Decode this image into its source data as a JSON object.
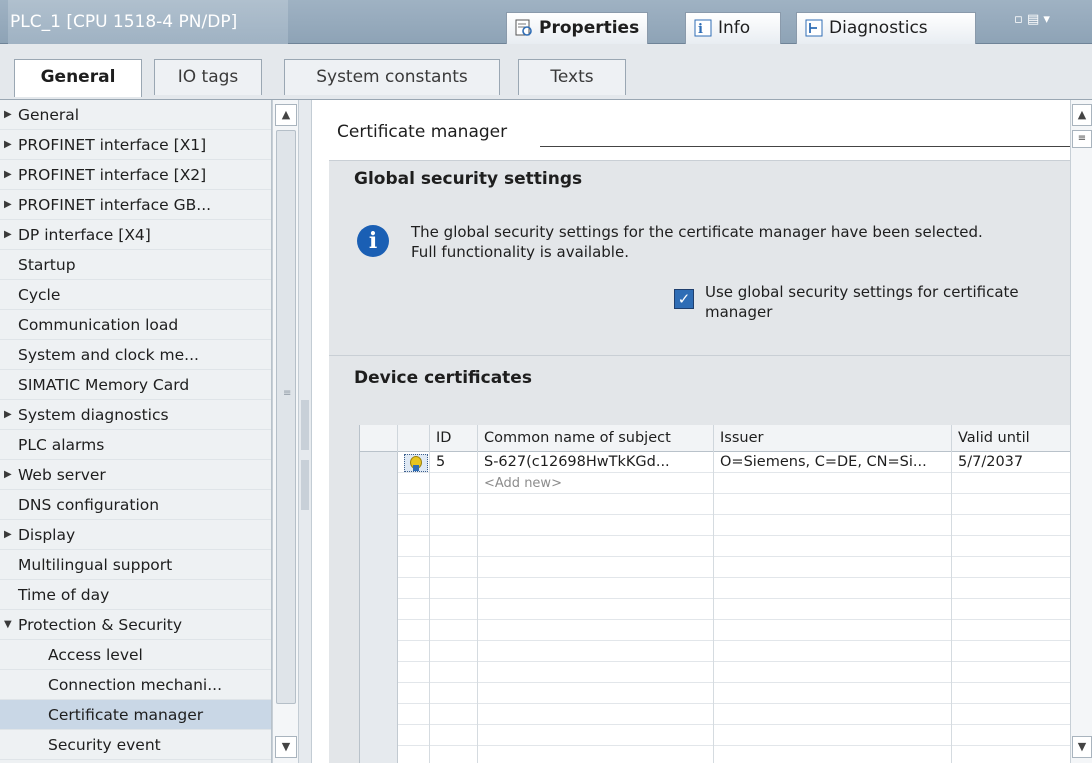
{
  "title_bar": {
    "title": "PLC_1 [CPU 1518-4 PN/DP]",
    "tabs": [
      {
        "label": "Properties",
        "icon": "properties-icon"
      },
      {
        "label": "Info",
        "icon": "info-tab-icon"
      },
      {
        "label": "Diagnostics",
        "icon": "diagnostics-icon"
      }
    ],
    "window_controls": "▫ ▤ ▾"
  },
  "sub_tabs": [
    "General",
    "IO tags",
    "System constants",
    "Texts"
  ],
  "nav": {
    "items": [
      {
        "label": "General",
        "arrow": "▶"
      },
      {
        "label": "PROFINET interface [X1]",
        "arrow": "▶"
      },
      {
        "label": "PROFINET interface [X2]",
        "arrow": "▶"
      },
      {
        "label": "PROFINET interface GB...",
        "arrow": "▶"
      },
      {
        "label": "DP interface [X4]",
        "arrow": "▶"
      },
      {
        "label": "Startup",
        "arrow": ""
      },
      {
        "label": "Cycle",
        "arrow": ""
      },
      {
        "label": "Communication load",
        "arrow": ""
      },
      {
        "label": "System and clock me...",
        "arrow": ""
      },
      {
        "label": "SIMATIC Memory Card",
        "arrow": ""
      },
      {
        "label": "System diagnostics",
        "arrow": "▶"
      },
      {
        "label": "PLC alarms",
        "arrow": ""
      },
      {
        "label": "Web server",
        "arrow": "▶"
      },
      {
        "label": "DNS configuration",
        "arrow": ""
      },
      {
        "label": "Display",
        "arrow": "▶"
      },
      {
        "label": "Multilingual support",
        "arrow": ""
      },
      {
        "label": "Time of day",
        "arrow": ""
      },
      {
        "label": "Protection & Security",
        "arrow": "▼"
      },
      {
        "label": "Access level",
        "arrow": ""
      },
      {
        "label": "Connection mechani...",
        "arrow": ""
      },
      {
        "label": "Certificate manager",
        "arrow": ""
      },
      {
        "label": "Security event",
        "arrow": ""
      }
    ],
    "selected": "Certificate manager"
  },
  "main": {
    "heading": "Certificate manager",
    "global": {
      "title": "Global security settings",
      "info_line1": "The global security settings for the certificate manager have been selected.",
      "info_line2": "Full functionality is available.",
      "checkbox_line1": "Use global security settings for certificate",
      "checkbox_line2": "manager",
      "checkbox_checked": true
    },
    "device": {
      "title": "Device certificates",
      "columns": [
        "ID",
        "Common name of subject",
        "Issuer",
        "Valid until"
      ],
      "rows": [
        {
          "id": "5",
          "subject": "S-627(c12698HwTkKGd...",
          "issuer": "O=Siemens, C=DE, CN=Si...",
          "valid": "5/7/2037"
        }
      ],
      "add_new": "<Add new>"
    }
  },
  "colors": {
    "accent": "#2f6db5",
    "title_bar": "#9fb2c3",
    "selected": "#c9d7e6"
  }
}
